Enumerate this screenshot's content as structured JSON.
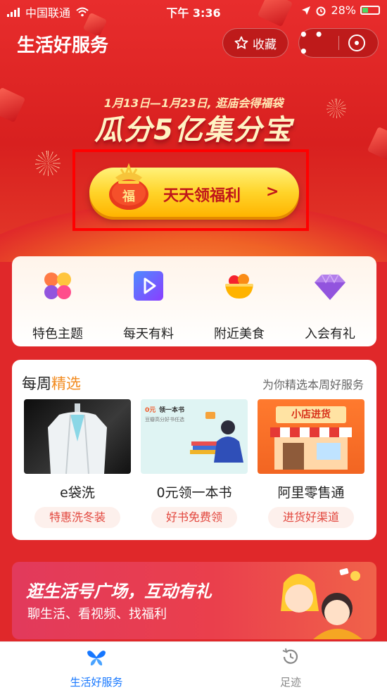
{
  "status_bar": {
    "carrier": "中国联通",
    "time": "下午 3:36",
    "battery": "28%"
  },
  "header": {
    "title": "生活好服务",
    "favorite_label": "收藏"
  },
  "promo": {
    "date_range": "1月13日—1月23日, 逛庙会得福袋",
    "headline": "瓜分5亿集分宝",
    "cta_label": "天天领福利",
    "bag_char": "福"
  },
  "quick_entries": [
    {
      "label": "特色主题",
      "icon": "theme-icon"
    },
    {
      "label": "每天有料",
      "icon": "play-icon"
    },
    {
      "label": "附近美食",
      "icon": "food-bowl-icon"
    },
    {
      "label": "入会有礼",
      "icon": "diamond-icon"
    }
  ],
  "weekly": {
    "title_prefix": "每周",
    "title_accent": "精选",
    "subtitle": "为你精选本周好服务",
    "items": [
      {
        "name": "e袋洗",
        "tag": "特惠洗冬装"
      },
      {
        "name": "0元领一本书",
        "tag": "好书免费领",
        "img_title": "领一本书",
        "img_price": "0元",
        "img_sub": "豆瓣高分好书任选"
      },
      {
        "name": "阿里零售通",
        "tag": "进货好渠道",
        "img_title": "小店进货"
      }
    ]
  },
  "banner": {
    "title": "逛生活号广场，互动有礼",
    "subtitle": "聊生活、看视频、找福利"
  },
  "tabbar": [
    {
      "label": "生活好服务",
      "active": true
    },
    {
      "label": "足迹",
      "active": false
    }
  ],
  "colors": {
    "brand_red": "#e0282a",
    "active_tab": "#1677ff",
    "tag_red": "#e2463d",
    "accent_orange": "#f28a1d"
  }
}
